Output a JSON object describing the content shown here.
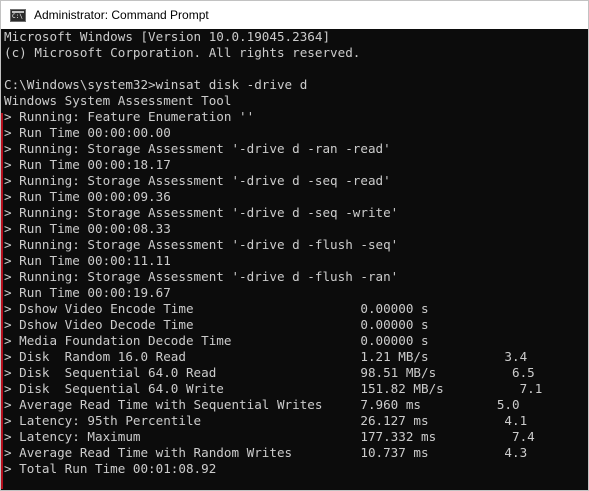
{
  "window": {
    "title": "Administrator: Command Prompt",
    "icon": "cmd-prompt-icon",
    "colors": {
      "console_background": "#0c0c0c",
      "console_text": "#cccccc",
      "titlebar_background": "#ffffff",
      "accent_marks": "#c50f1f"
    }
  },
  "console": {
    "lines": [
      "Microsoft Windows [Version 10.0.19045.2364]",
      "(c) Microsoft Corporation. All rights reserved.",
      "",
      "C:\\Windows\\system32>winsat disk -drive d",
      "Windows System Assessment Tool",
      "> Running: Feature Enumeration ''",
      "> Run Time 00:00:00.00",
      "> Running: Storage Assessment '-drive d -ran -read'",
      "> Run Time 00:00:18.17",
      "> Running: Storage Assessment '-drive d -seq -read'",
      "> Run Time 00:00:09.36",
      "> Running: Storage Assessment '-drive d -seq -write'",
      "> Run Time 00:00:08.33",
      "> Running: Storage Assessment '-drive d -flush -seq'",
      "> Run Time 00:00:11.11",
      "> Running: Storage Assessment '-drive d -flush -ran'",
      "> Run Time 00:00:19.67",
      "> Dshow Video Encode Time                      0.00000 s",
      "> Dshow Video Decode Time                      0.00000 s",
      "> Media Foundation Decode Time                 0.00000 s",
      "> Disk  Random 16.0 Read                       1.21 MB/s          3.4",
      "> Disk  Sequential 64.0 Read                   98.51 MB/s          6.5",
      "> Disk  Sequential 64.0 Write                  151.82 MB/s          7.1",
      "> Average Read Time with Sequential Writes     7.960 ms          5.0",
      "> Latency: 95th Percentile                     26.127 ms          4.1",
      "> Latency: Maximum                             177.332 ms          7.4",
      "> Average Read Time with Random Writes         10.737 ms          4.3",
      "> Total Run Time 00:01:08.92"
    ]
  }
}
